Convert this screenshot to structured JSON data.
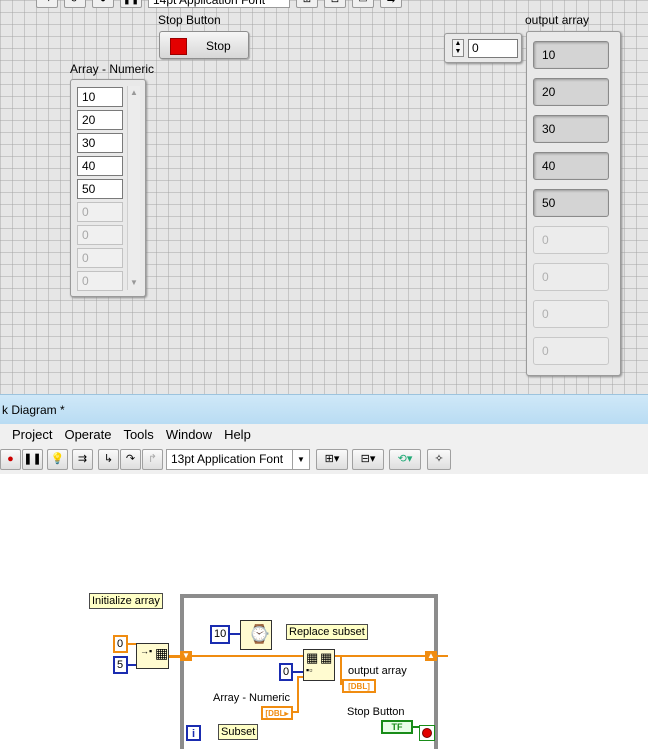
{
  "front_panel": {
    "toolbar": {
      "font_label": "14pt Application Font"
    },
    "stop_button": {
      "label": "Stop Button",
      "text": "Stop"
    },
    "array_numeric": {
      "label": "Array - Numeric",
      "values": [
        "10",
        "20",
        "30",
        "40",
        "50"
      ],
      "empty_values": [
        "0",
        "0",
        "0",
        "0"
      ]
    },
    "index_display": {
      "value": "0"
    },
    "output_array": {
      "label": "output array",
      "values": [
        "10",
        "20",
        "30",
        "40",
        "50"
      ],
      "empty_values": [
        "0",
        "0",
        "0",
        "0"
      ]
    }
  },
  "block_diagram": {
    "window_title": "k Diagram *",
    "menu": [
      "Project",
      "Operate",
      "Tools",
      "Window",
      "Help"
    ],
    "toolbar": {
      "font_label": "13pt Application Font"
    },
    "nodes": {
      "initialize_array_label": "Initialize array",
      "init_element_const": "0",
      "init_size_const": "5",
      "wait_const": "10",
      "replace_subset_label": "Replace subset",
      "index_const": "0",
      "output_array_label": "output array",
      "array_numeric_label": "Array - Numeric",
      "stop_button_label": "Stop Button",
      "subset_label": "Subset",
      "iteration_label": "i",
      "dbl_type": "DBL",
      "bool_type": "TF"
    }
  },
  "colors": {
    "numeric_wire": "#f08c10",
    "integer_wire": "#1a2cb0",
    "boolean_wire": "#188c18",
    "stop_led": "#e30000",
    "title_bar": "#cfe8f8"
  }
}
